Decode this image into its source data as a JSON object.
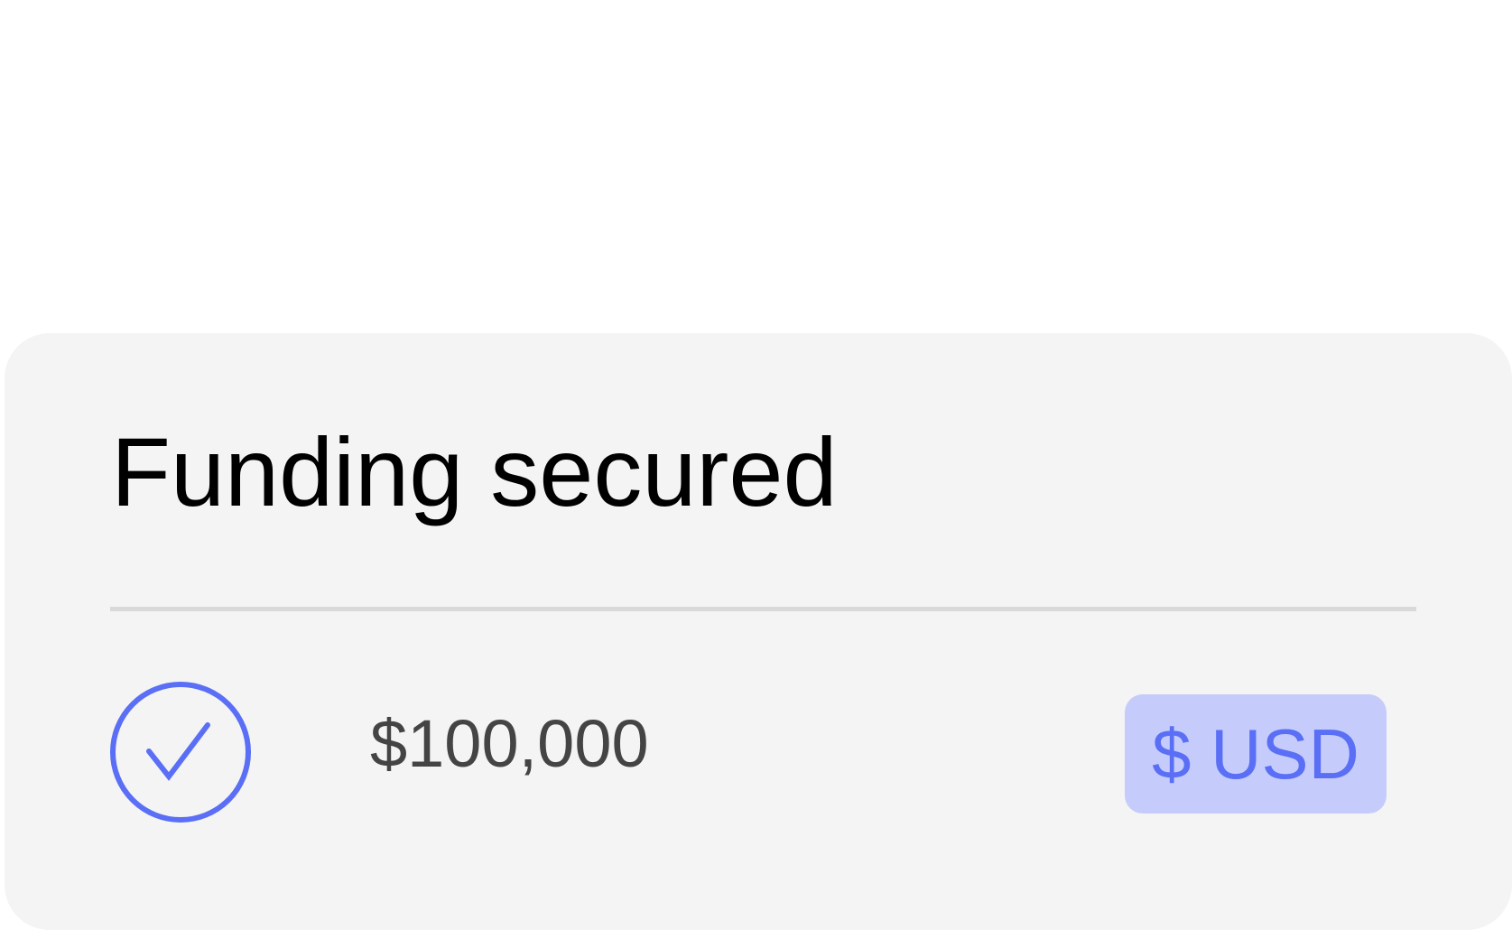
{
  "card": {
    "title": "Funding secured",
    "status_icon": "check-circle-icon",
    "amount": "$100,000",
    "currency_badge": "$ USD"
  },
  "colors": {
    "accent": "#5a6ff5",
    "badge_background": "#c5ccfb",
    "card_background": "#f4f4f4",
    "divider": "#d9d9d9",
    "title_text": "#000000",
    "amount_text": "#444444"
  }
}
